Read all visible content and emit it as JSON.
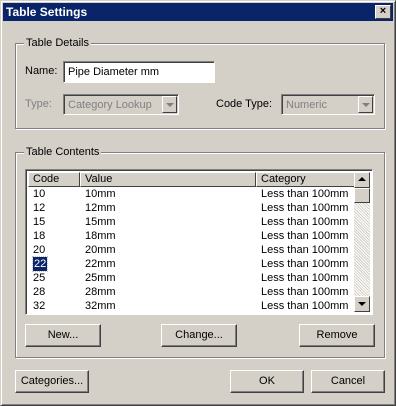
{
  "window": {
    "title": "Table Settings",
    "close_glyph": "×"
  },
  "details": {
    "group_label": "Table Details",
    "name_label": "Name:",
    "name_value": "Pipe Diameter mm",
    "type_label": "Type:",
    "type_value": "Category Lookup",
    "code_type_label": "Code Type:",
    "code_type_value": "Numeric"
  },
  "contents": {
    "group_label": "Table Contents",
    "columns": [
      "Code",
      "Value",
      "Category"
    ],
    "rows": [
      {
        "code": "10",
        "value": "10mm",
        "category": "Less than 100mm"
      },
      {
        "code": "12",
        "value": "12mm",
        "category": "Less than 100mm"
      },
      {
        "code": "15",
        "value": "15mm",
        "category": "Less than 100mm"
      },
      {
        "code": "18",
        "value": "18mm",
        "category": "Less than 100mm"
      },
      {
        "code": "20",
        "value": "20mm",
        "category": "Less than 100mm"
      },
      {
        "code": "22",
        "value": "22mm",
        "category": "Less than 100mm",
        "selected": true
      },
      {
        "code": "25",
        "value": "25mm",
        "category": "Less than 100mm"
      },
      {
        "code": "28",
        "value": "28mm",
        "category": "Less than 100mm"
      },
      {
        "code": "32",
        "value": "32mm",
        "category": "Less than 100mm"
      }
    ],
    "buttons": {
      "new": "New...",
      "change": "Change...",
      "remove": "Remove"
    }
  },
  "footer": {
    "categories": "Categories...",
    "ok": "OK",
    "cancel": "Cancel"
  },
  "colors": {
    "titlebar": "#0a246a",
    "face": "#d4d0c8",
    "selection": "#0a246a"
  }
}
